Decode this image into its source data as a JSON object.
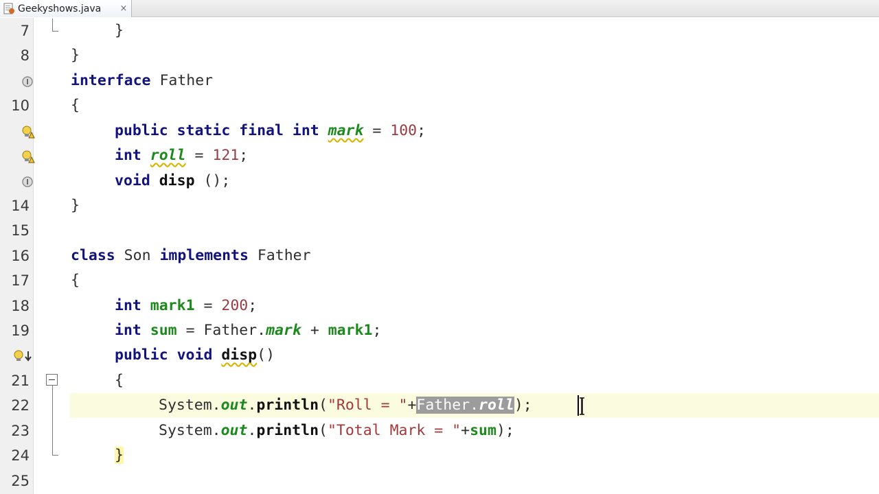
{
  "tab": {
    "title": "Geekyshows.java",
    "close_glyph": "×"
  },
  "gutter": {
    "line_numbers": [
      "7",
      "8",
      "",
      "10",
      "",
      "",
      "",
      "14",
      "15",
      "16",
      "17",
      "18",
      "19",
      "",
      "21",
      "22",
      "23",
      "24",
      "25"
    ]
  },
  "code": {
    "l7": "}",
    "l8": "}",
    "l9_kw": "interface",
    "l9_name": " Father",
    "l10": "{",
    "l11_kw": "public static final int",
    "l11_field": "mark",
    "l11_eq": " = ",
    "l11_num": "100",
    "l11_end": ";",
    "l12_kw": "int",
    "l12_field": "roll",
    "l12_eq": " = ",
    "l12_num": "121",
    "l12_end": ";",
    "l13_kw": "void",
    "l13_meth": "disp",
    "l13_end": " ();",
    "l14": "}",
    "l16_kw1": "class",
    "l16_name": " Son ",
    "l16_kw2": "implements",
    "l16_iface": " Father",
    "l17": "{",
    "l18_kw": "int",
    "l18_field": "mark1",
    "l18_eq": " = ",
    "l18_num": "200",
    "l18_end": ";",
    "l19_kw": "int",
    "l19_field": "sum",
    "l19_mid": " = Father.",
    "l19_sfield": "mark",
    "l19_plus": " + ",
    "l19_field2": "mark1",
    "l19_end": ";",
    "l20_kw": "public void",
    "l20_meth": "disp",
    "l20_end": "()",
    "l21": "{",
    "l22_sys": "System.",
    "l22_out": "out",
    "l22_dot": ".",
    "l22_meth": "println",
    "l22_open": "(",
    "l22_str": "\"Roll = \"",
    "l22_plus": "+",
    "l22_sel1": "Father.",
    "l22_sel2": "roll",
    "l22_end": ");",
    "l23_sys": "System.",
    "l23_out": "out",
    "l23_dot": ".",
    "l23_meth": "println",
    "l23_open": "(",
    "l23_str": "\"Total Mark = \"",
    "l23_plus": "+",
    "l23_field": "sum",
    "l23_end": ");",
    "l24": "}"
  },
  "icons": {
    "tab": "java-file-icon",
    "line9": "implementation-marker-icon",
    "line11": "warning-bulb-icon",
    "line12": "warning-bulb-icon",
    "line13": "implementation-marker-icon",
    "line20": "warning-override-icon"
  }
}
